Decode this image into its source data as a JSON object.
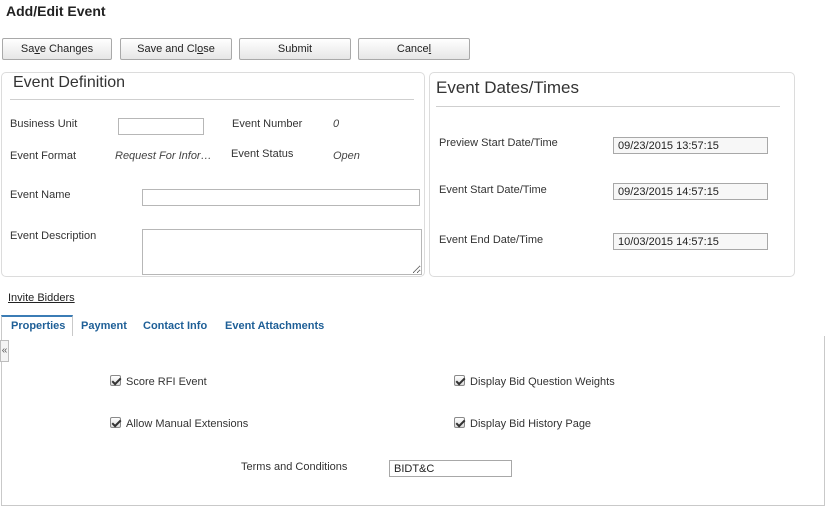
{
  "page": {
    "title": "Add/Edit Event"
  },
  "toolbar": {
    "save_changes": {
      "pre": "Sa",
      "key": "v",
      "post": "e Changes"
    },
    "save_close": {
      "pre": "Save and Cl",
      "key": "o",
      "post": "se"
    },
    "submit": "Submit",
    "cancel": {
      "pre": "Cance",
      "key": "l",
      "post": ""
    }
  },
  "event_definition": {
    "title": "Event Definition",
    "business_unit_label": "Business Unit",
    "business_unit_value": "",
    "event_number_label": "Event Number",
    "event_number_value": "0",
    "event_format_label": "Event Format",
    "event_format_value": "Request For Infor…",
    "event_status_label": "Event Status",
    "event_status_value": "Open",
    "event_name_label": "Event Name",
    "event_name_value": "",
    "event_description_label": "Event Description",
    "event_description_value": ""
  },
  "event_dates": {
    "title": "Event Dates/Times",
    "preview_start_label": "Preview Start Date/Time",
    "preview_start_value": "09/23/2015 13:57:15",
    "event_start_label": "Event Start Date/Time",
    "event_start_value": "09/23/2015 14:57:15",
    "event_end_label": "Event End Date/Time",
    "event_end_value": "10/03/2015 14:57:15"
  },
  "invite_bidders": "Invite Bidders",
  "tabs": [
    {
      "label": "Properties",
      "active": true
    },
    {
      "label": "Payment",
      "active": false
    },
    {
      "label": "Contact Info",
      "active": false
    },
    {
      "label": "Event Attachments",
      "active": false
    }
  ],
  "collapse_glyph": "«",
  "properties": {
    "score_rfi": {
      "label": "Score RFI Event",
      "checked": true
    },
    "allow_manual_extensions": {
      "label": "Allow Manual Extensions",
      "checked": true
    },
    "display_bid_question_weights": {
      "label": "Display Bid Question Weights",
      "checked": true
    },
    "display_bid_history_page": {
      "label": "Display Bid History Page",
      "checked": true
    },
    "terms_label": "Terms and Conditions",
    "terms_value": "BIDT&C"
  }
}
